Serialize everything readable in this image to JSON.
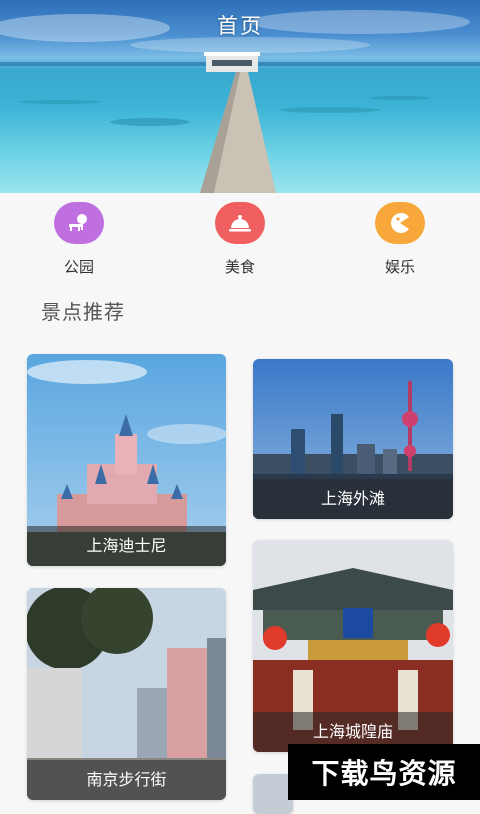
{
  "header": {
    "title": "首页"
  },
  "categories": [
    {
      "label": "公园",
      "icon": "park-bench-icon",
      "color": "#c06fe0"
    },
    {
      "label": "美食",
      "icon": "food-cloche-icon",
      "color": "#f06060"
    },
    {
      "label": "娱乐",
      "icon": "game-icon",
      "color": "#f8a83a"
    }
  ],
  "section": {
    "title": "景点推荐"
  },
  "spots": [
    {
      "name": "上海迪士尼"
    },
    {
      "name": "上海外滩"
    },
    {
      "name": "南京步行街"
    },
    {
      "name": "上海城隍庙"
    }
  ],
  "watermark": {
    "text": "下载鸟资源"
  }
}
